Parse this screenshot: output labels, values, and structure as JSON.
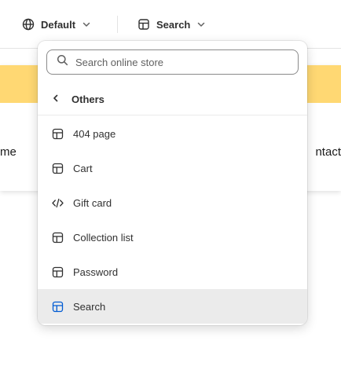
{
  "toolbar": {
    "theme_label": "Default",
    "template_label": "Search"
  },
  "preview": {
    "nav_left_text": "me",
    "nav_right_text": "ntact",
    "announcement_color": "#ffd873"
  },
  "dropdown": {
    "search_placeholder": "Search online store",
    "back_label": "Others",
    "items": [
      {
        "label": "404 page",
        "icon": "template-icon"
      },
      {
        "label": "Cart",
        "icon": "template-icon"
      },
      {
        "label": "Gift card",
        "icon": "code-icon"
      },
      {
        "label": "Collection list",
        "icon": "template-icon"
      },
      {
        "label": "Password",
        "icon": "template-icon"
      },
      {
        "label": "Search",
        "icon": "template-icon",
        "selected": true
      }
    ],
    "selected_icon_color": "#005bd3"
  }
}
